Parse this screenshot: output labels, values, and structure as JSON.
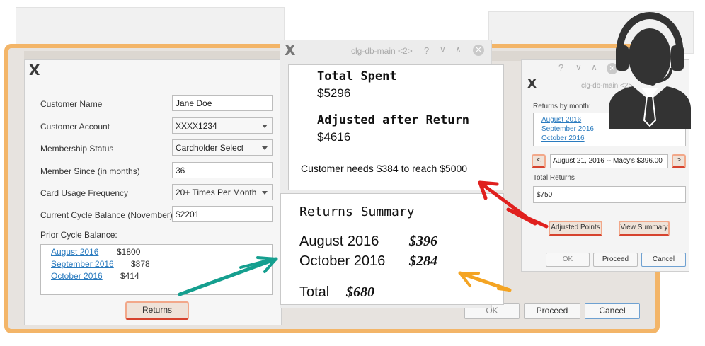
{
  "main_dialog": {
    "labels": {
      "customer_name": "Customer Name",
      "customer_account": "Customer Account",
      "membership_status": "Membership Status",
      "member_since": "Member Since (in months)",
      "card_usage": "Card Usage Frequency",
      "current_balance": "Current Cycle Balance (November)",
      "prior_balance": "Prior Cycle Balance:"
    },
    "values": {
      "customer_name": "Jane Doe",
      "customer_account": "XXXX1234",
      "membership_status": "Cardholder Select",
      "member_since": "36",
      "card_usage": "20+ Times Per Month",
      "current_balance": "$2201"
    },
    "prior_cycles": [
      {
        "month": "August 2016",
        "amount": "$1800"
      },
      {
        "month": "September 2016",
        "amount": "$878"
      },
      {
        "month": "October 2016",
        "amount": "$414"
      }
    ],
    "returns_button": "Returns"
  },
  "bottom_buttons": {
    "ok": "OK",
    "proceed": "Proceed",
    "cancel": "Cancel"
  },
  "center_popup": {
    "title": "clg-db-main <2>",
    "total_spent_heading": "Total Spent",
    "total_spent_value": "$5296",
    "adjusted_heading": "Adjusted after Return",
    "adjusted_value": "$4616",
    "needs_text": "Customer needs $384 to reach $5000"
  },
  "returns_summary": {
    "title": "Returns Summary",
    "rows": [
      {
        "month": "August 2016",
        "amount": "$396"
      },
      {
        "month": "October 2016",
        "amount": "$284"
      }
    ],
    "total_label": "Total",
    "total_amount": "$680"
  },
  "right_dialog": {
    "title": "clg-db-main <2>",
    "returns_by_month_label": "Returns by month:",
    "months": [
      "August 2016",
      "September 2016",
      "October 2016"
    ],
    "prev_label": "<",
    "next_label": ">",
    "selected_return": "August 21, 2016 -- Macy's $396.00",
    "total_returns_label": "Total Returns",
    "total_returns_value": "$750",
    "adjusted_points_button": "Adjusted Points",
    "view_summary_button": "View Summary",
    "ok": "OK",
    "proceed": "Proceed",
    "cancel": "Cancel"
  },
  "icons": {
    "app_logo": "x-logo-icon",
    "agent": "support-agent-icon",
    "help": "question-icon",
    "collapse": "chevron-down-icon",
    "expand": "chevron-up-icon",
    "close": "close-icon"
  },
  "colors": {
    "highlight_orange": "#f3b568",
    "arrow_red": "#e0201e",
    "arrow_teal": "#159f8f",
    "arrow_orange": "#f4a423",
    "link_blue": "#2a7bbf"
  }
}
